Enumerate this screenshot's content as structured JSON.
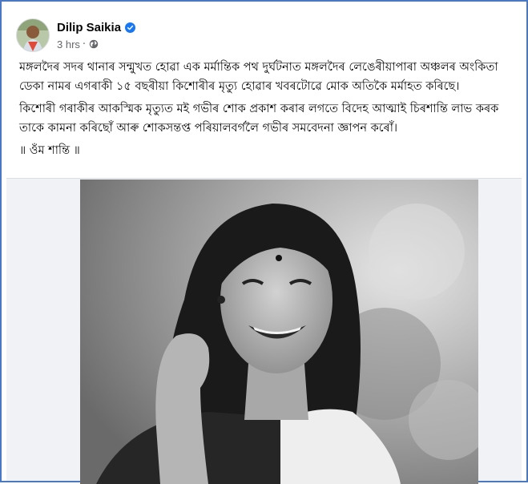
{
  "post": {
    "author": "Dilip Saikia",
    "verified_icon": "verified-badge-icon",
    "timestamp": "3 hrs",
    "separator": "·",
    "privacy_icon": "globe-icon",
    "paragraphs": [
      "মঙ্গলদৈৰ সদৰ থানাৰ সন্মুখত হোৱা এক মৰ্মান্তিক পথ দুৰ্ঘটনাত মঙ্গলদৈৰ লেঙেৰীয়াপাৰা অঞ্চলৰ অংকিতা ডেকা নামৰ এগৰাকী ১৫ বছৰীয়া কিশোৰীৰ মৃত্যু হোৱাৰ খবৰটোৱে মোক অতিকৈ মৰ্মাহত কৰিছে।",
      "কিশোৰী গৰাকীৰ আকস্মিক মৃত্যুত মই গভীৰ শোক প্ৰকাশ কৰাৰ লগতে বিদেহ আত্মাই চিৰশান্তি লাভ কৰক তাকে কামনা কৰিছোঁ আৰু শোকসন্তপ্ত পৰিয়ালবৰ্গলৈ গভীৰ সমবেদনা জ্ঞাপন কৰোঁ।",
      "॥ ওঁম শান্তি ॥"
    ]
  },
  "colors": {
    "frame_border": "#4a78c2",
    "verified_blue": "#1877f2",
    "meta_gray": "#65676b",
    "text": "#050505"
  }
}
